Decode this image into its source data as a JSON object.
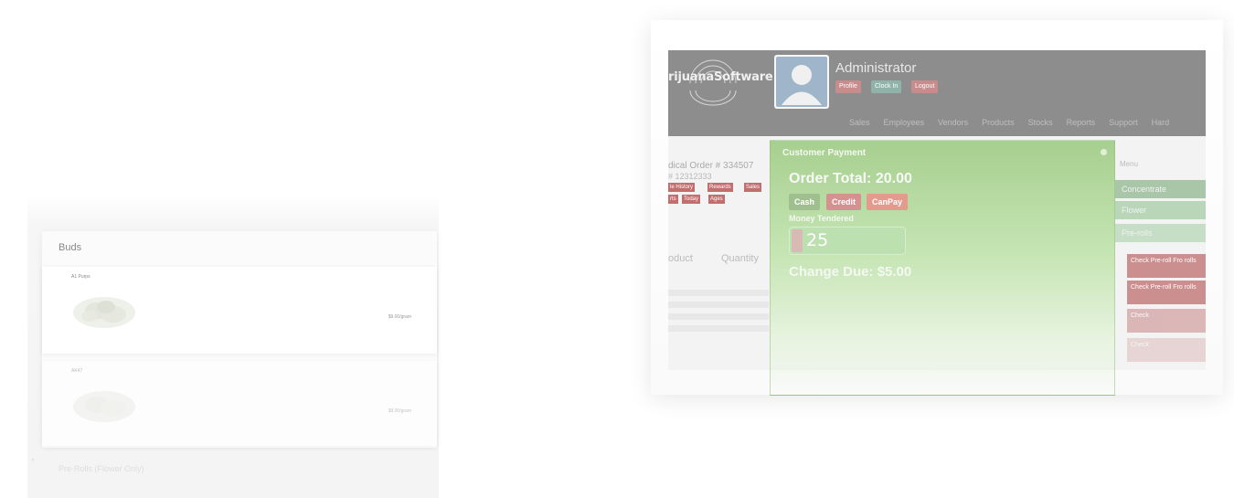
{
  "buds": {
    "title": "Buds",
    "items": [
      {
        "name": "A1 Purps",
        "price": "$9.00/gram"
      },
      {
        "name": "AK47",
        "price": "$9.00/gram"
      }
    ],
    "next_section": "Pre-Rolls (Flower Only)"
  },
  "pos": {
    "logo": "rijuanaSoftware",
    "user": {
      "name": "Administrator",
      "buttons": {
        "profile": "Profile",
        "clock_in": "Clock In",
        "logout": "Logout"
      }
    },
    "nav": [
      "Sales",
      "Employees",
      "Vendors",
      "Products",
      "Stocks",
      "Reports",
      "Support",
      "Hard"
    ],
    "order": {
      "title": "dical Order # 334507",
      "subtitle": "# 12312333",
      "tags": [
        "le History",
        "Rewards",
        "Sales",
        "rts",
        "Today",
        "Ages"
      ],
      "columns": {
        "product": "oduct",
        "quantity": "Quantity"
      }
    },
    "menu": {
      "title": "Menu",
      "items": [
        "Concentrate",
        "Flower",
        "Pre-rolls"
      ],
      "red_items": [
        "Check Pre-roll Fro rolls",
        "Check Pre-roll Fro rolls",
        "Check",
        "Check"
      ]
    }
  },
  "payment": {
    "title": "Customer Payment",
    "order_total_label": "Order Total:",
    "order_total": "20.00",
    "methods": {
      "cash": "Cash",
      "credit": "Credit",
      "canpay": "CanPay"
    },
    "money_tendered_label": "Money Tendered",
    "money_tendered_value": "25",
    "change_due_label": "Change Due:",
    "change_due_value": "$5.00"
  },
  "colors": {
    "header": "#8d8d8d",
    "modal_green": "#a7cf8f",
    "accent_red": "#c88c8c"
  }
}
